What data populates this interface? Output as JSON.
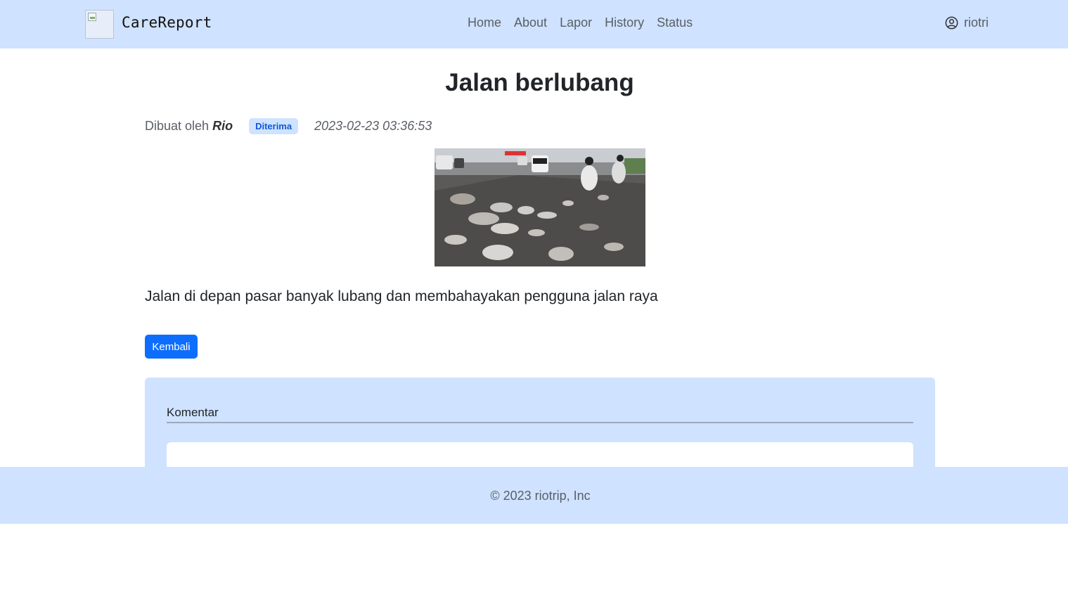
{
  "navbar": {
    "brand": "CareReport",
    "links": [
      "Home",
      "About",
      "Lapor",
      "History",
      "Status"
    ],
    "user": {
      "name": "riotri",
      "icon": "user-circle-icon"
    }
  },
  "report": {
    "title": "Jalan berlubang",
    "created_by_label": "Dibuat oleh",
    "author": "Rio",
    "status": "Diterima",
    "timestamp": "2023-02-23 03:36:53",
    "description": "Jalan di depan pasar banyak lubang dan membahayakan pengguna jalan raya"
  },
  "back_button": {
    "label": "Kembali"
  },
  "comments": {
    "title": "Komentar"
  },
  "footer": {
    "text": "© 2023 riotrip, Inc"
  },
  "colors": {
    "navbar_bg": "#cfe2ff",
    "primary": "#0d6efd",
    "badge_bg": "#cfe2ff",
    "badge_text": "#0d5ad4"
  }
}
